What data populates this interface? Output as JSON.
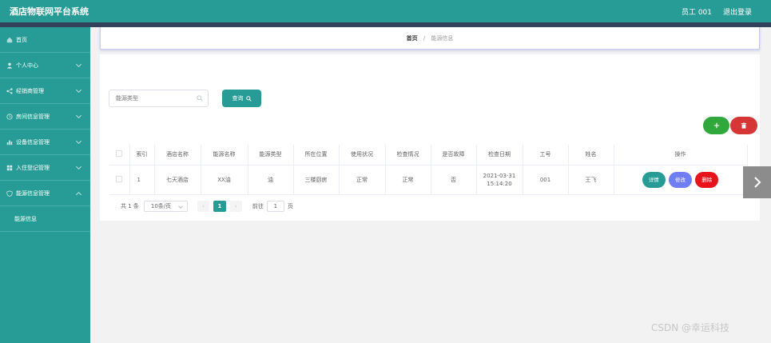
{
  "header": {
    "title": "酒店物联网平台系统",
    "user": "员工 001",
    "logout": "退出登录"
  },
  "sidebar": {
    "items": [
      {
        "label": "首页"
      },
      {
        "label": "个人中心"
      },
      {
        "label": "经销商管理"
      },
      {
        "label": "房间信息管理"
      },
      {
        "label": "设备信息管理"
      },
      {
        "label": "入住登记管理"
      },
      {
        "label": "能源信息管理"
      },
      {
        "label": "能源信息"
      }
    ]
  },
  "breadcrumb": {
    "home": "首页",
    "separator": "/",
    "current": "能源信息"
  },
  "search": {
    "placeholder": "能源类型",
    "button": "查询"
  },
  "table": {
    "headers": [
      "索引",
      "酒店名称",
      "能源名称",
      "能源类型",
      "所在位置",
      "使用状况",
      "检查情况",
      "是否故障",
      "检查日期",
      "工号",
      "姓名",
      "操作"
    ],
    "rows": [
      {
        "index": "1",
        "hotel": "七天酒店",
        "energy_name": "XX油",
        "energy_type": "油",
        "location": "三楼厨房",
        "usage": "正常",
        "inspection": "正常",
        "fault": "否",
        "date": "2021-03-31",
        "time": "15:14:20",
        "emp_no": "001",
        "name": "王飞",
        "btn_detail": "详情",
        "btn_edit": "修改",
        "btn_delete": "删除"
      }
    ]
  },
  "pagination": {
    "total": "共 1 条",
    "page_size": "10条/页",
    "prev": "‹",
    "current_page": "1",
    "next": "›",
    "goto_label": "前往",
    "goto_value": "1",
    "goto_unit": "页"
  },
  "watermark": "CSDN @幸运科技",
  "colors": {
    "primary": "#279c96",
    "header_dark": "#33415a",
    "add": "#31a83b",
    "delete": "#d63636",
    "edit": "#6f7ef2",
    "delete_op": "#e8141b"
  }
}
